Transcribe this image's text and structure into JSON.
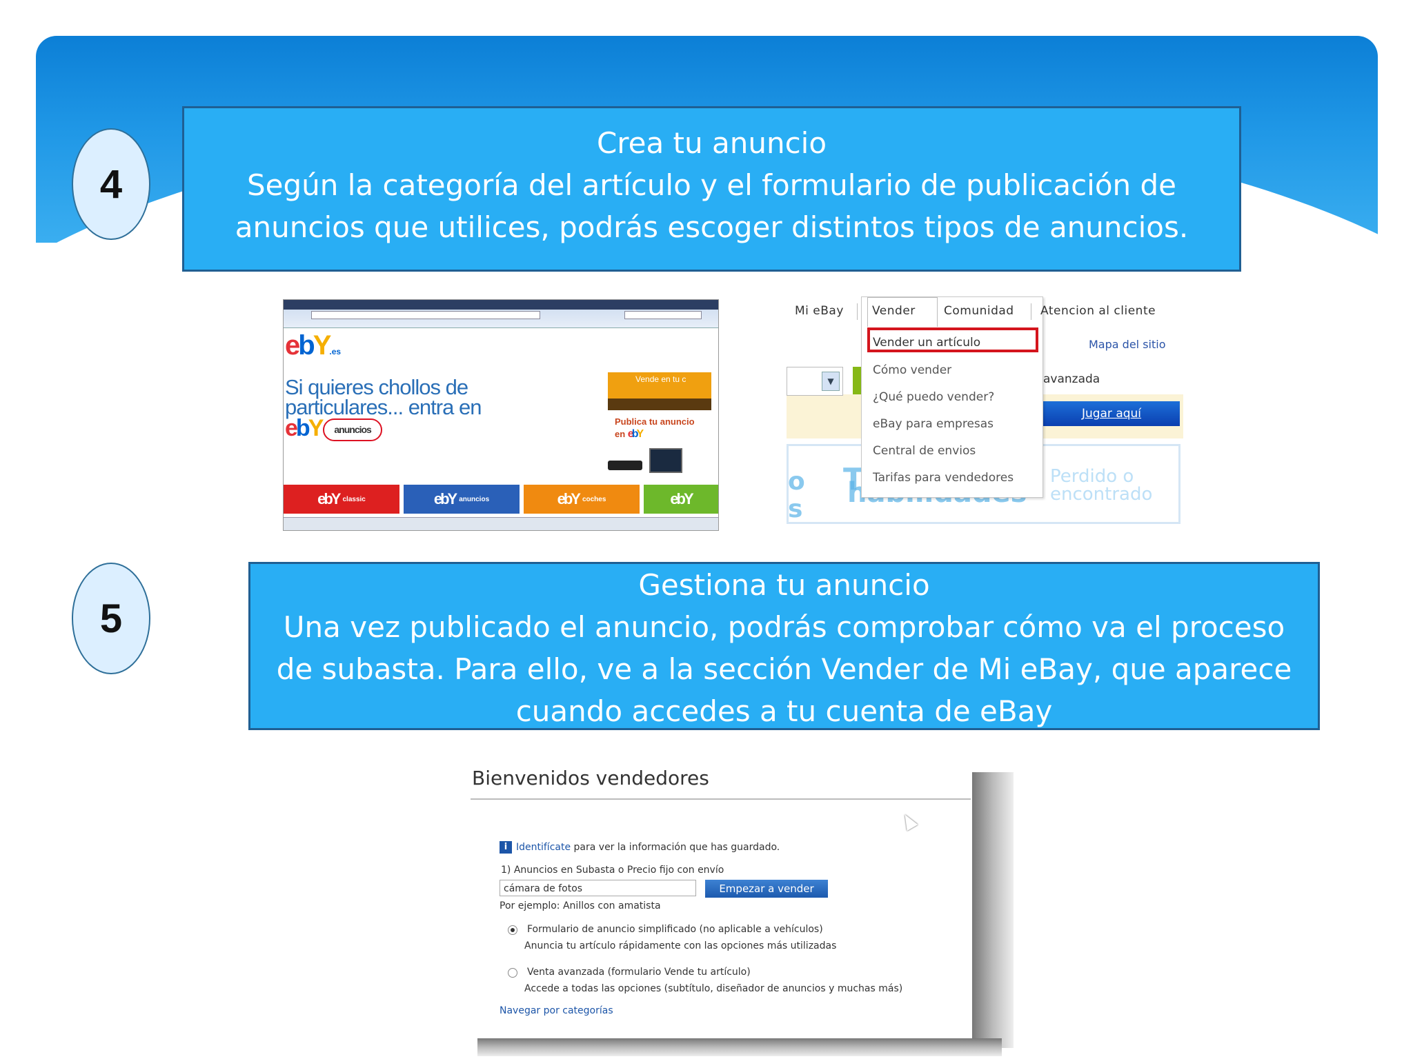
{
  "step4": {
    "number": "4",
    "title": "Crea tu anuncio",
    "line1": "Según la categoría del artículo y el formulario de publicación de",
    "line2": "anuncios que utilices, podrás escoger distintos tipos de anuncios."
  },
  "step5": {
    "number": "5",
    "title": "Gestiona tu anuncio",
    "line1": "Una vez publicado el anuncio, podrás comprobar cómo va el proceso",
    "line2": "de subasta. Para ello, ve a la sección Vender de Mi eBay, que aparece",
    "line3": "cuando accedes a tu cuenta de eBay"
  },
  "ebay_home": {
    "logo_suffix": ".es",
    "chollos_line1": "Si quieres chollos de",
    "chollos_line2": "particulares... entra en",
    "anuncios_label": "anuncios",
    "promo_top": "Vende en tu c",
    "promo_line1": "Publica tu anuncio",
    "promo_line2": "en",
    "tiles": [
      "classic",
      "anuncios",
      "coches",
      ""
    ]
  },
  "menu": {
    "tabs": [
      "Mi eBay",
      "Vender",
      "Comunidad",
      "Atencion al cliente"
    ],
    "items": [
      "Vender un artículo",
      "Cómo vender",
      "¿Qué puedo vender?",
      "eBay para empresas",
      "Central de envios",
      "Tarifas para vendedores"
    ],
    "mapa": "Mapa del sitio",
    "avanzada": "avanzada",
    "jugar": "Jugar aquí",
    "bg_word": "habilidades",
    "bg_t": "T",
    "bg_o": "o",
    "bg_s": "s",
    "bg_perdido1": "Perdido o",
    "bg_perdido2": "encontrado"
  },
  "seller": {
    "title": "Bienvenidos vendedores",
    "identify_link": "Identifícate",
    "identify_rest": " para ver la información que has guardado.",
    "section1": "1) Anuncios en Subasta o Precio fijo con envío",
    "input_value": "cámara de fotos",
    "button": "Empezar a vender",
    "example": "Por ejemplo: Anillos con amatista",
    "opt1_title": "Formulario de anuncio simplificado (no aplicable a vehículos)",
    "opt1_desc": "Anuncia tu artículo rápidamente con las opciones más utilizadas",
    "opt2_title": "Venta avanzada (formulario Vende tu artículo)",
    "opt2_desc": "Accede a todas las opciones (subtítulo, diseñador de anuncios y muchas más)",
    "browse": "Navegar por categorías"
  }
}
